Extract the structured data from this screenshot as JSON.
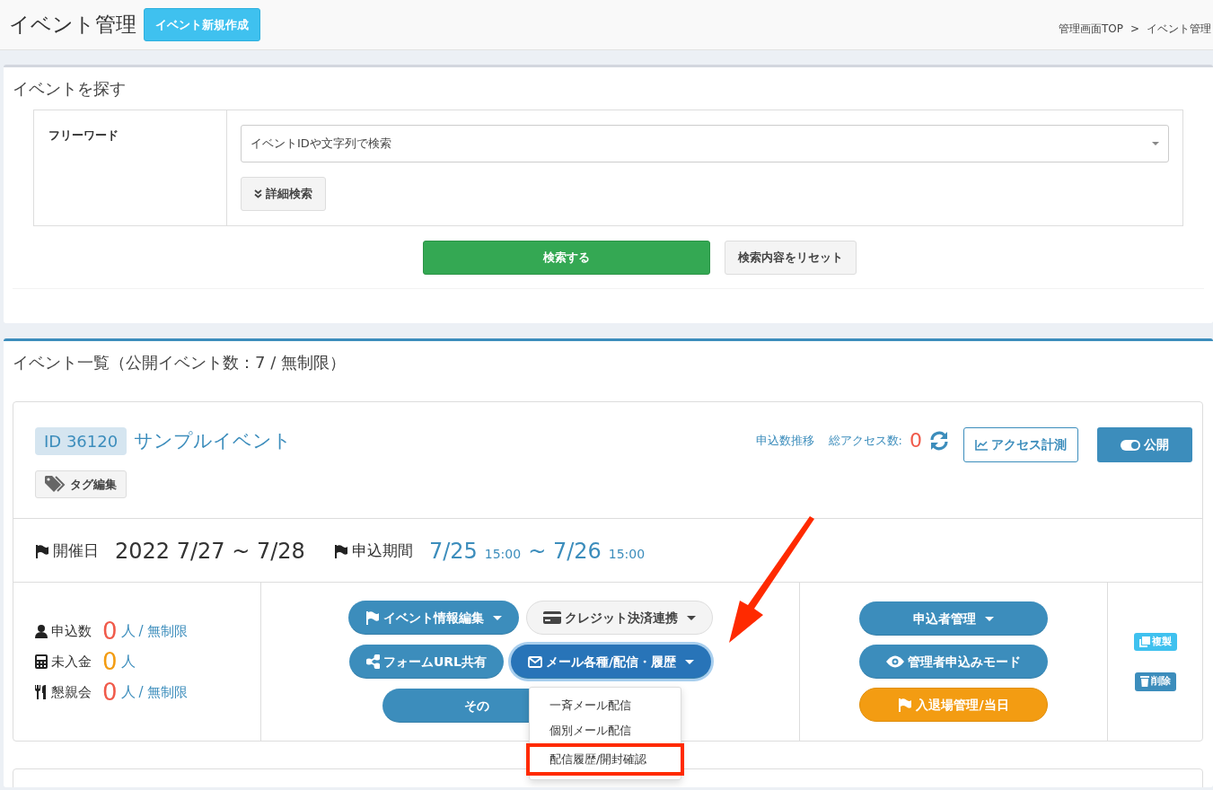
{
  "header": {
    "title": "イベント管理",
    "new_button": "イベント新規作成",
    "breadcrumbs": [
      "管理画面TOP",
      ">",
      "イベント管理"
    ]
  },
  "search_panel": {
    "title": "イベントを探す",
    "freeword_label": "フリーワード",
    "search_field": {
      "placeholder": "イベントIDや文字列で検索"
    },
    "advanced_button": "詳細検索",
    "submit_button": "検索する",
    "reset_button": "検索内容をリセット"
  },
  "list_panel": {
    "title": "イベント一覧（公開イベント数：7 / 無制限）",
    "event": {
      "id": "ID 36120",
      "name": "サンプルイベント",
      "tag_button": "タグ編集",
      "trend_link": "申込数推移",
      "access_label": "総アクセス数:",
      "access_count": "0",
      "access_button": "アクセス計測",
      "publish_button": "公開",
      "published": true,
      "date_label": "開催日",
      "date_value": "2022 7/27 ~ 7/28",
      "period_label": "申込期間",
      "period": [
        {
          "kind": "date",
          "text": "7/25"
        },
        {
          "kind": "time",
          "text": "15:00"
        },
        {
          "kind": "date",
          "text": "~ 7/26"
        },
        {
          "kind": "time",
          "text": "15:00"
        }
      ],
      "stats": [
        {
          "kind": "user",
          "label": "申込数",
          "count": "0",
          "unit": "人",
          "limit": "/ 無制限"
        },
        {
          "kind": "calc",
          "label": "未入金",
          "count": "0",
          "unit": "人"
        },
        {
          "kind": "food",
          "label": "懇親会",
          "count": "0",
          "unit": "人",
          "limit": "/ 無制限"
        }
      ],
      "actions": [
        {
          "kind": "flag",
          "label": "イベント情報編集",
          "caret": true,
          "active": false
        },
        {
          "kind": "card",
          "label": "クレジット決済連携",
          "caret": true,
          "active": false
        },
        {
          "kind": "share",
          "label": "フォームURL共有",
          "caret": false,
          "active": false
        },
        {
          "kind": "mail",
          "label": "メール各種/配信・履歴",
          "caret": true,
          "active": true
        },
        {
          "kind": "none",
          "label": "その",
          "caret": false,
          "active": false
        }
      ],
      "dropdown": [
        {
          "label": "一斉メール配信",
          "highlighted": false
        },
        {
          "label": "個別メール配信",
          "highlighted": false
        },
        {
          "label": "配信履歴/開封確認",
          "highlighted": true
        }
      ],
      "manage": [
        {
          "kind": "none",
          "label": "申込者管理",
          "caret": true
        },
        {
          "kind": "eye",
          "label": "管理者申込みモード",
          "caret": false
        },
        {
          "kind": "flag",
          "label": "入退場管理/当日",
          "caret": false
        }
      ],
      "small_buttons": [
        {
          "kind": "copy",
          "label": "複製",
          "color": "#3fc1ef"
        },
        {
          "kind": "trash",
          "label": "削除",
          "color": "#3c8dbc"
        }
      ]
    }
  }
}
